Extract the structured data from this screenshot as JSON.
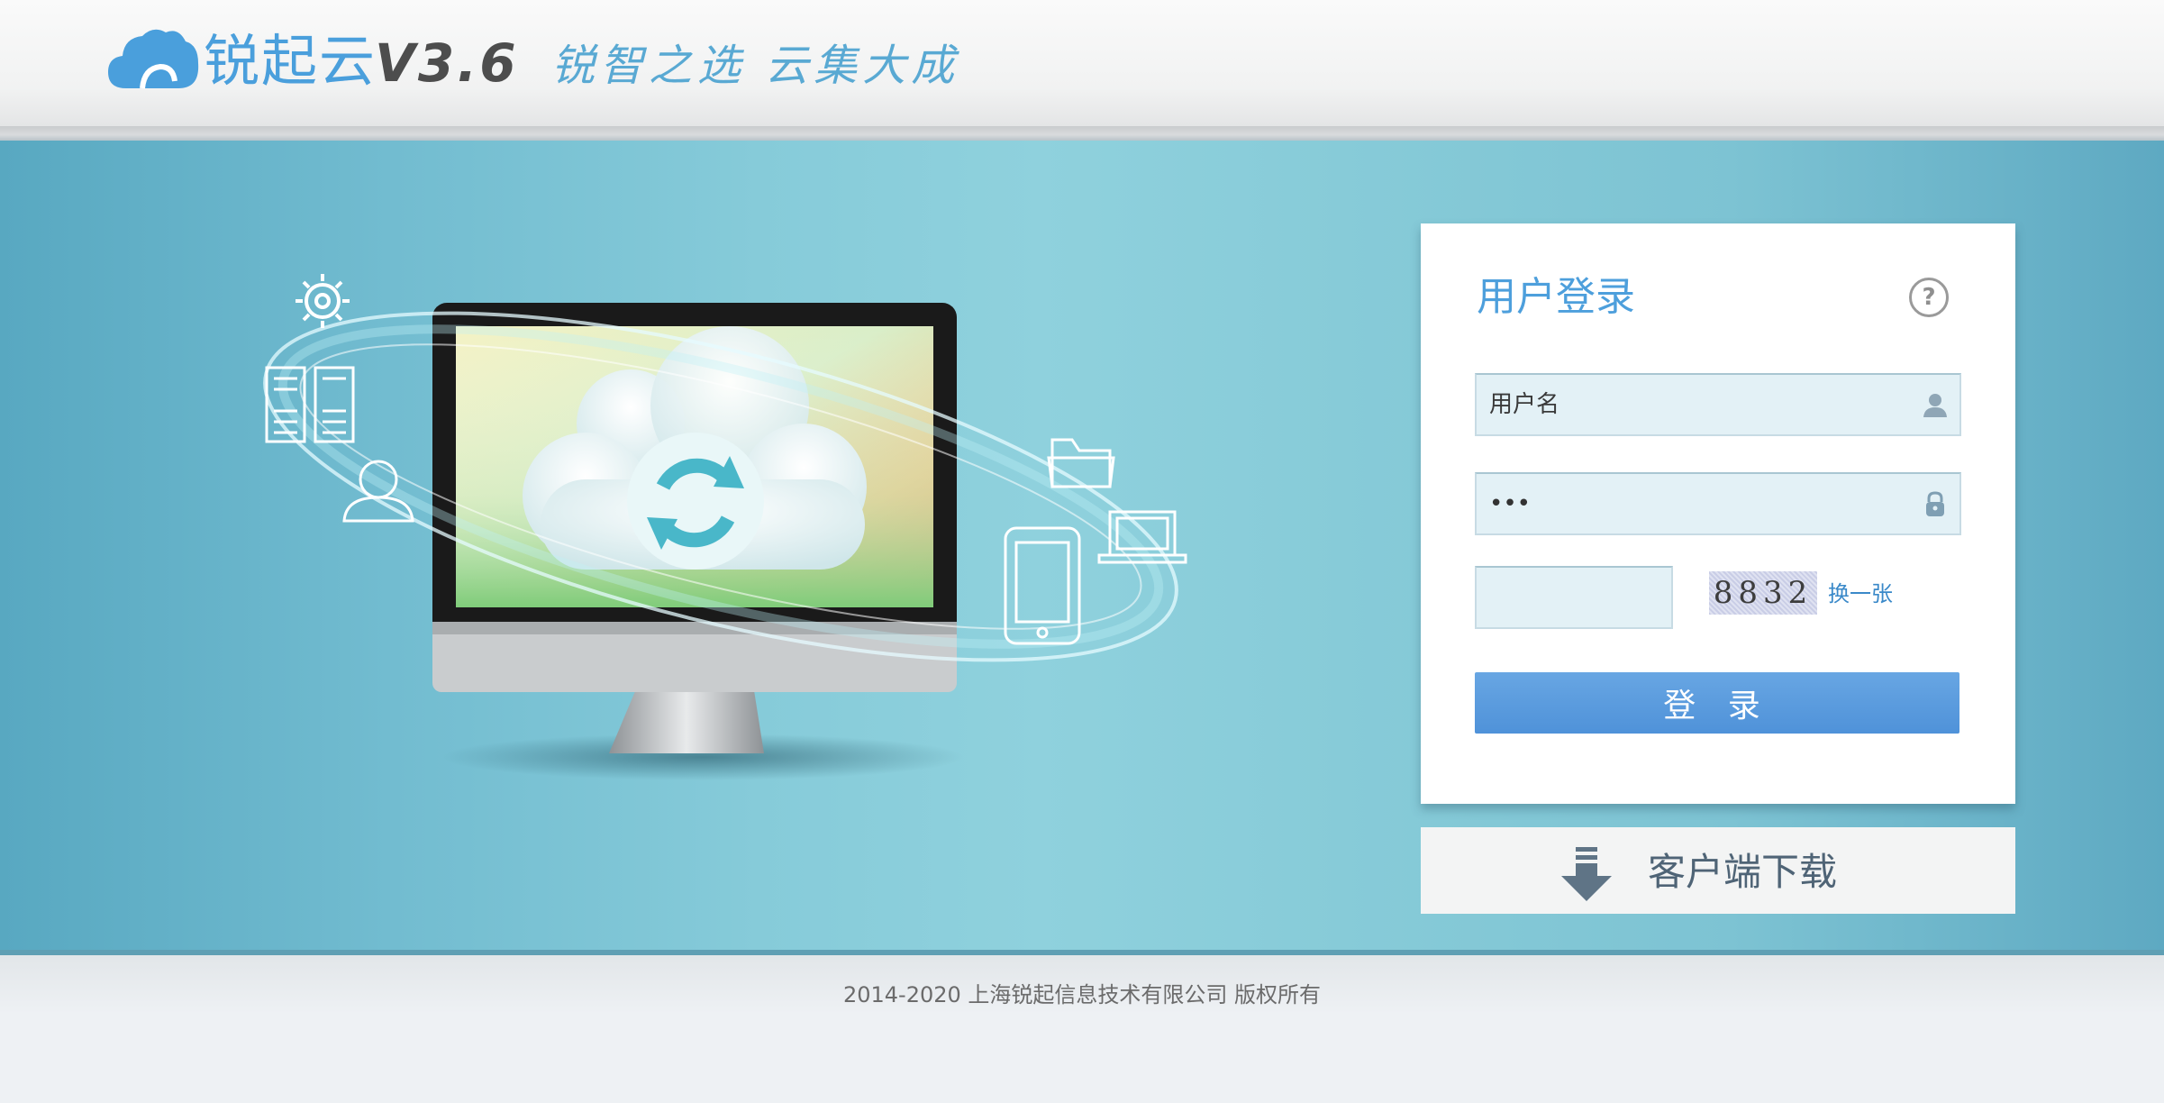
{
  "header": {
    "brand": "锐起云",
    "version": "V3.6",
    "slogan": "锐智之选 云集大成"
  },
  "login": {
    "title": "用户登录",
    "help_icon": "question-circle-icon",
    "username_placeholder": "用户名",
    "username_value": "",
    "password_value": "•••",
    "captcha_value": "",
    "captcha_image_text": "8832",
    "captcha_refresh": "换一张",
    "submit": "登 录"
  },
  "download": {
    "label": "客户端下载",
    "icon": "download-arrow-icon"
  },
  "footer": {
    "copyright": "2014-2020 上海锐起信息技术有限公司 版权所有"
  },
  "colors": {
    "accent": "#4d9fdc",
    "banner": "#86cbd9",
    "button": "#5a9bdf"
  }
}
